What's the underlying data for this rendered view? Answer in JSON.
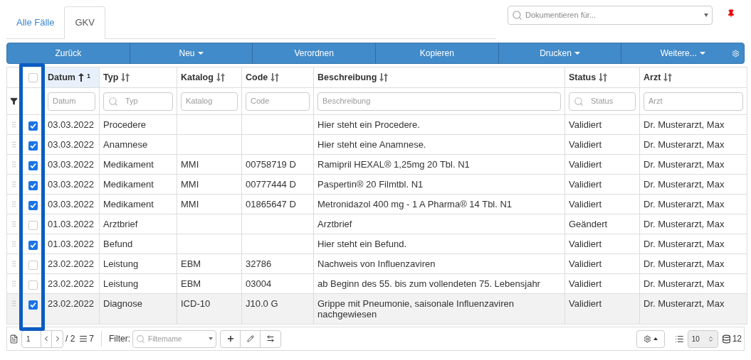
{
  "tabs": [
    {
      "label": "Alle Fälle",
      "selected": false
    },
    {
      "label": "GKV",
      "selected": true
    }
  ],
  "document_for": {
    "placeholder": "Dokumentieren für..."
  },
  "toolbar": [
    {
      "label": "Zurück",
      "dropdown": false
    },
    {
      "label": "Neu",
      "dropdown": true
    },
    {
      "label": "Verordnen",
      "dropdown": false
    },
    {
      "label": "Kopieren",
      "dropdown": false
    },
    {
      "label": "Drucken",
      "dropdown": true
    },
    {
      "label": "Weitere...",
      "dropdown": true
    }
  ],
  "table": {
    "select_all": {
      "checked": false
    },
    "columns": [
      {
        "label": "Datum",
        "sorted": true,
        "sort_order": "1",
        "filter": {
          "kind": "text",
          "placeholder": "Datum"
        }
      },
      {
        "label": "Typ",
        "sorted": false,
        "filter": {
          "kind": "search",
          "placeholder": "Typ"
        }
      },
      {
        "label": "Katalog",
        "sorted": false,
        "filter": {
          "kind": "text",
          "placeholder": "Katalog"
        }
      },
      {
        "label": "Code",
        "sorted": false,
        "filter": {
          "kind": "text",
          "placeholder": "Code"
        }
      },
      {
        "label": "Beschreibung",
        "sorted": false,
        "filter": {
          "kind": "text",
          "placeholder": "Beschreibung"
        }
      },
      {
        "label": "Status",
        "sorted": false,
        "filter": {
          "kind": "search",
          "placeholder": "Status"
        }
      },
      {
        "label": "Arzt",
        "sorted": false,
        "filter": {
          "kind": "text",
          "placeholder": "Arzt"
        }
      }
    ],
    "rows": [
      {
        "checked": true,
        "selected": false,
        "cells": [
          "03.03.2022",
          "Procedere",
          "",
          "",
          "Hier steht ein Procedere.",
          "Validiert",
          "Dr. Musterarzt, Max"
        ]
      },
      {
        "checked": true,
        "selected": false,
        "cells": [
          "03.03.2022",
          "Anamnese",
          "",
          "",
          "Hier steht eine Anamnese.",
          "Validiert",
          "Dr. Musterarzt, Max"
        ]
      },
      {
        "checked": true,
        "selected": false,
        "cells": [
          "03.03.2022",
          "Medikament",
          "MMI",
          "00758719 D",
          "Ramipril HEXAL® 1,25mg 20 Tbl. N1",
          "Validiert",
          "Dr. Musterarzt, Max"
        ]
      },
      {
        "checked": true,
        "selected": false,
        "cells": [
          "03.03.2022",
          "Medikament",
          "MMI",
          "00777444 D",
          "Paspertin® 20 Filmtbl. N1",
          "Validiert",
          "Dr. Musterarzt, Max"
        ]
      },
      {
        "checked": true,
        "selected": false,
        "cells": [
          "03.03.2022",
          "Medikament",
          "MMI",
          "01865647 D",
          "Metronidazol 400 mg - 1 A Pharma® 14 Tbl. N1",
          "Validiert",
          "Dr. Musterarzt, Max"
        ]
      },
      {
        "checked": false,
        "selected": false,
        "cells": [
          "01.03.2022",
          "Arztbrief",
          "",
          "",
          "Arztbrief",
          "Geändert",
          "Dr. Musterarzt, Max"
        ]
      },
      {
        "checked": true,
        "selected": false,
        "cells": [
          "01.03.2022",
          "Befund",
          "",
          "",
          "Hier steht ein Befund.",
          "Validiert",
          "Dr. Musterarzt, Max"
        ]
      },
      {
        "checked": false,
        "selected": false,
        "cells": [
          "23.02.2022",
          "Leistung",
          "EBM",
          "32786",
          "Nachweis von Influenzaviren",
          "Validiert",
          "Dr. Musterarzt, Max"
        ]
      },
      {
        "checked": false,
        "selected": false,
        "cells": [
          "23.02.2022",
          "Leistung",
          "EBM",
          "03004",
          "ab Beginn des 55. bis zum vollendeten 75. Lebensjahr",
          "Validiert",
          "Dr. Musterarzt, Max"
        ]
      },
      {
        "checked": true,
        "selected": true,
        "cells": [
          "23.02.2022",
          "Diagnose",
          "ICD-10",
          "J10.0 G",
          "Grippe mit Pneumonie, saisonale Influenzaviren nachgewiesen",
          "Validiert",
          "Dr. Musterarzt, Max"
        ]
      }
    ]
  },
  "footer": {
    "page": "1",
    "pages": "/ 2",
    "page_count_badge": "7",
    "filter_label": "Filter:",
    "filter_placeholder": "Filtername",
    "page_size": "10",
    "total": "12"
  }
}
